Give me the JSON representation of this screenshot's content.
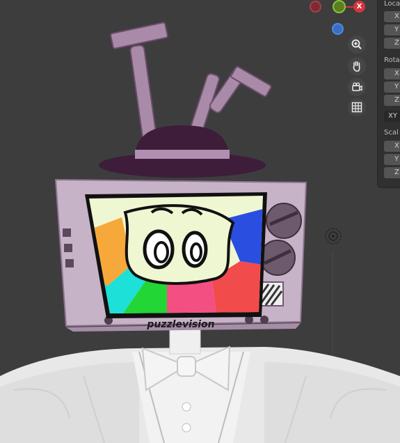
{
  "gizmo": {
    "x_axis_label": "X",
    "colors": {
      "x_axis": "#d8343c",
      "y_axis": "#8ac43a",
      "z_axis": "#4f8ae0"
    }
  },
  "nav_tools": [
    {
      "name": "zoom",
      "icon": "zoom-in-icon"
    },
    {
      "name": "pan",
      "icon": "hand-icon"
    },
    {
      "name": "camera",
      "icon": "camera-icon"
    },
    {
      "name": "ortho",
      "icon": "grid-icon"
    }
  ],
  "transform_panel": {
    "location_label": "Loca",
    "location_fields": [
      "X",
      "Y",
      "Z"
    ],
    "rotation_label": "Rota",
    "rotation_fields": [
      "X",
      "Y",
      "Z"
    ],
    "rotation_mode": "XY",
    "scale_label": "Scal",
    "scale_fields": [
      "X",
      "Y",
      "Z"
    ]
  },
  "model": {
    "screen_logo_text": "puzzlevision",
    "colors": {
      "tv_body": "#c7b3c8",
      "hat": "#3d1d3a",
      "hat_band": "#b08fb1",
      "screen_bg": "#eef7d2",
      "suit": "#e6e6e6"
    }
  }
}
